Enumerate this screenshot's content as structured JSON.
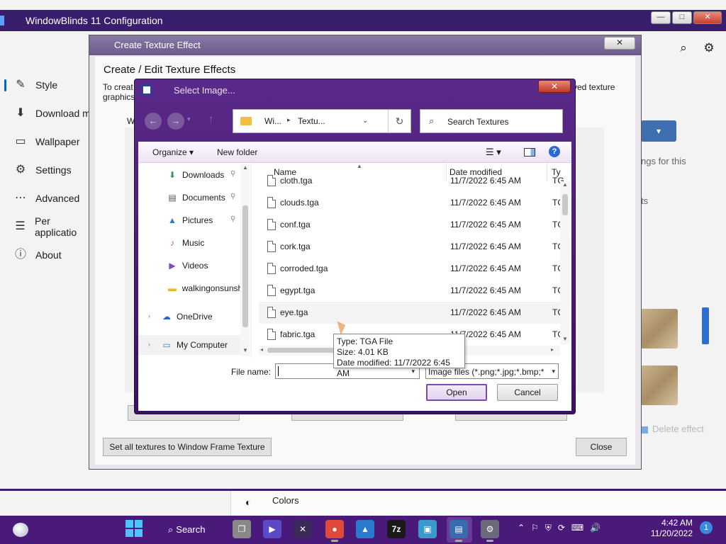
{
  "app": {
    "title": "WindowBlinds 11 Configuration",
    "min": "—",
    "max": "□",
    "close": "✕",
    "sidebar": [
      {
        "label": "Style",
        "icon": "brush-icon",
        "glyph": "✎"
      },
      {
        "label": "Download m",
        "icon": "download-icon",
        "glyph": "⬇"
      },
      {
        "label": "Wallpaper",
        "icon": "wallpaper-icon",
        "glyph": "▭"
      },
      {
        "label": "Settings",
        "icon": "gear-icon",
        "glyph": "⚙"
      },
      {
        "label": "Advanced",
        "icon": "more-icon",
        "glyph": "⋯"
      },
      {
        "label": "Per applicatio",
        "icon": "list-icon",
        "glyph": "☰"
      },
      {
        "label": "About",
        "icon": "info-icon",
        "glyph": "ⓘ"
      }
    ],
    "right_text1": "ngs for this",
    "right_text2": "ts",
    "delete_effect": "Delete effect",
    "colors_label": "Colors"
  },
  "cte": {
    "title": "Create Texture Effect",
    "close": "✕",
    "heading": "Create / Edit Texture Effects",
    "desc1": "To creat",
    "desc2": "graphics",
    "desc_right": "ved texture",
    "w_label": "W",
    "set_all_button": "Set all textures to Window Frame Texture",
    "close_button": "Close"
  },
  "select_image": {
    "title": "Select Image...",
    "close": "✕",
    "address": {
      "part1": "Wi...",
      "part2": "Textu..."
    },
    "search_placeholder": "Search Textures",
    "toolbar": {
      "organize": "Organize ▾",
      "new_folder": "New folder",
      "view": "☰ ▾",
      "help": "?"
    },
    "nav_items": [
      {
        "label": "Downloads",
        "icon": "download-icon",
        "glyph": "⬇",
        "color": "#2a9a5a",
        "pinned": true
      },
      {
        "label": "Documents",
        "icon": "documents-icon",
        "glyph": "▤",
        "color": "#555555",
        "pinned": true
      },
      {
        "label": "Pictures",
        "icon": "pictures-icon",
        "glyph": "▲",
        "color": "#2a7ad0",
        "pinned": true
      },
      {
        "label": "Music",
        "icon": "music-icon",
        "glyph": "♪",
        "color": "#d05a4a",
        "pinned": false
      },
      {
        "label": "Videos",
        "icon": "videos-icon",
        "glyph": "▶",
        "color": "#7a4ac0",
        "pinned": false
      },
      {
        "label": "walkingonsunsh",
        "icon": "folder-icon",
        "glyph": "▬",
        "color": "#e8b830",
        "pinned": false
      },
      {
        "label": "OneDrive",
        "icon": "onedrive-icon",
        "glyph": "☁",
        "color": "#1a6ad0",
        "pinned": false
      },
      {
        "label": "My Computer",
        "icon": "computer-icon",
        "glyph": "▭",
        "color": "#2a8ad0",
        "pinned": false
      }
    ],
    "columns": {
      "name": "Name",
      "date": "Date modified",
      "type": "Ty"
    },
    "files": [
      {
        "name": "cloth.tga",
        "date": "11/7/2022 6:45 AM",
        "type": "TG"
      },
      {
        "name": "clouds.tga",
        "date": "11/7/2022 6:45 AM",
        "type": "TG"
      },
      {
        "name": "conf.tga",
        "date": "11/7/2022 6:45 AM",
        "type": "TG"
      },
      {
        "name": "cork.tga",
        "date": "11/7/2022 6:45 AM",
        "type": "TG"
      },
      {
        "name": "corroded.tga",
        "date": "11/7/2022 6:45 AM",
        "type": "TG"
      },
      {
        "name": "egypt.tga",
        "date": "11/7/2022 6:45 AM",
        "type": "TG"
      },
      {
        "name": "eye.tga",
        "date": "11/7/2022 6:45 AM",
        "type": "TG"
      },
      {
        "name": "fabric.tga",
        "date": "11/7/2022 6:45 AM",
        "type": "TG"
      }
    ],
    "file_name_label": "File name:",
    "file_name_value": "",
    "file_type": "Image files (*.png;*.jpg;*.bmp;*",
    "open_button": "Open",
    "cancel_button": "Cancel",
    "tooltip": {
      "type": "Type: TGA File",
      "size": "Size: 4.01 KB",
      "date": "Date modified: 11/7/2022 6:45 AM"
    }
  },
  "taskbar": {
    "search_label": "Search",
    "apps": [
      {
        "name": "taskview",
        "glyph": "❐",
        "bg": "#888888"
      },
      {
        "name": "meet",
        "glyph": "▶",
        "bg": "#5a4ac8"
      },
      {
        "name": "xtools",
        "glyph": "✕",
        "bg": "#3a2a5a"
      },
      {
        "name": "chrome",
        "glyph": "●",
        "bg": "#e04a3a"
      },
      {
        "name": "photos",
        "glyph": "▲",
        "bg": "#2a7ad0"
      },
      {
        "name": "7zip",
        "glyph": "7z",
        "bg": "#1a1a1a"
      },
      {
        "name": "monitor",
        "glyph": "▣",
        "bg": "#3a9ad0"
      },
      {
        "name": "windowblinds",
        "glyph": "▤",
        "bg": "#3a6ab0"
      },
      {
        "name": "settings",
        "glyph": "⚙",
        "bg": "#6a6a7a"
      }
    ],
    "tray": [
      "⌃",
      "⚐",
      "⛨",
      "⟳",
      "⌨",
      "🔊"
    ],
    "time": "4:42 AM",
    "date": "11/20/2022",
    "notifications": "1"
  }
}
